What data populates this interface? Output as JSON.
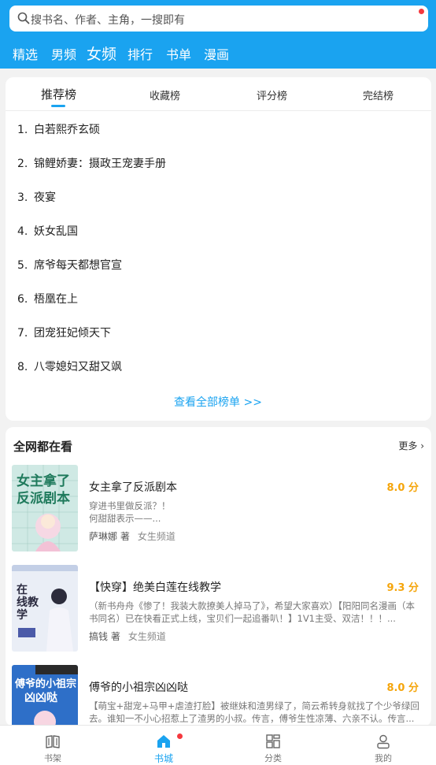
{
  "search": {
    "placeholder": "搜书名、作者、主角，一搜即有",
    "icon": "search-icon"
  },
  "channels": [
    "精选",
    "男频",
    "女频",
    "排行",
    "书单",
    "漫画"
  ],
  "active_channel": "女频",
  "rank_tabs": [
    "推荐榜",
    "收藏榜",
    "评分榜",
    "完结榜"
  ],
  "active_rank_tab": "推荐榜",
  "rank_list": [
    {
      "num": "1.",
      "title": "白若熙乔玄硕"
    },
    {
      "num": "2.",
      "title": "锦鲤娇妻：摄政王宠妻手册"
    },
    {
      "num": "3.",
      "title": "夜宴"
    },
    {
      "num": "4.",
      "title": "妖女乱国"
    },
    {
      "num": "5.",
      "title": "席爷每天都想官宣"
    },
    {
      "num": "6.",
      "title": "梧凰在上"
    },
    {
      "num": "7.",
      "title": "团宠狂妃倾天下"
    },
    {
      "num": "8.",
      "title": "八零媳妇又甜又飒"
    }
  ],
  "view_all": "查看全部榜单 >>",
  "section": {
    "title": "全网都在看",
    "more": "更多"
  },
  "books": [
    {
      "title": "女主拿了反派剧本",
      "score": "8.0 分",
      "desc": "穿进书里做反派？！\n        何甜甜表示——...",
      "author": "萨琳娜 著",
      "channel": "女生频道",
      "cover_text": "女主拿了反派剧本",
      "cover_color": "#cfe9e4"
    },
    {
      "title": "【快穿】绝美白莲在线教学",
      "score": "9.3 分",
      "desc": "（新书舟舟《惨了！我装大款撩美人掉马了》，希望大家喜欢）【阳阳同名漫画（本书同名）已在快看正式上线，宝贝们一起追番叭！】1V1主受、双洁！！！...",
      "author": "搞钱 著",
      "channel": "女生频道",
      "cover_text": "在线教学",
      "cover_color": "#eaeef6"
    },
    {
      "title": "傅爷的小祖宗凶凶哒",
      "score": "8.0 分",
      "desc": "【萌宝+甜宠+马甲+虐渣打脸】被继妹和渣男绿了，简云希转身就找了个少爷绿回去。谁知一不小心招惹上了渣男的小叔。传言，傅爷生性凉薄、六亲不认。传言...",
      "author": "",
      "channel": "",
      "cover_text": "傅爷的小祖宗凶凶哒",
      "cover_color": "#2e6fc8"
    }
  ],
  "tabbar": [
    {
      "label": "书架",
      "icon": "bookshelf-icon"
    },
    {
      "label": "书城",
      "icon": "bookstore-icon"
    },
    {
      "label": "分类",
      "icon": "category-icon"
    },
    {
      "label": "我的",
      "icon": "profile-icon"
    }
  ],
  "active_tab": "书城",
  "colors": {
    "accent": "#1aa3f0",
    "score": "#f5a50b",
    "badge": "#f5383e"
  }
}
